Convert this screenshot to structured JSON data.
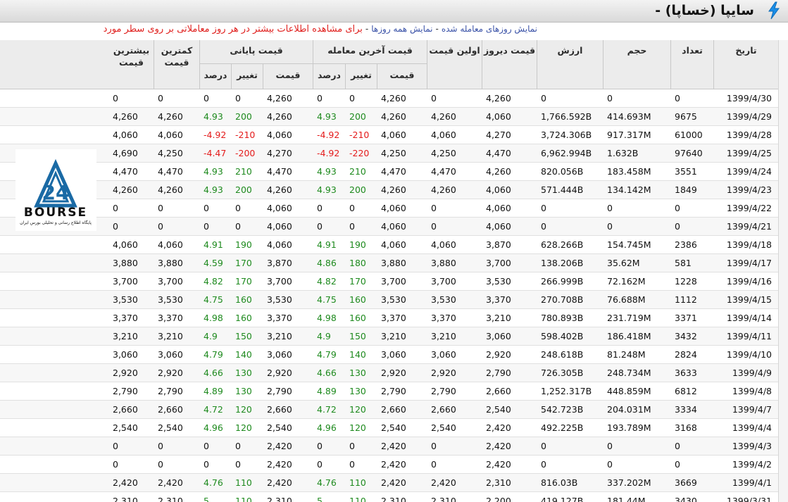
{
  "title": "سایپا (خساپا) -",
  "title_icon": "lightning-icon",
  "info_links": {
    "traded_days": "نمایش روزهای معامله شده",
    "all_days": "نمایش همه روزها",
    "separator": "-",
    "info_text": "برای مشاهده اطلاعات بیشتر در هر روز معاملاتی بر روی سطر مورد"
  },
  "headers": {
    "date": "تاریخ",
    "count": "تعداد",
    "volume": "حجم",
    "value": "ارزش",
    "yesterday_price": "قیمت دیروز",
    "first_price": "اولین قیمت",
    "last_trade_price": "قیمت آخرین معامله",
    "final_price": "قیمت پایانی",
    "price": "قیمت",
    "change": "تغییر",
    "percent": "درصد",
    "lowest_price": "کمترین قیمت",
    "highest_price": "بیشترین قیمت"
  },
  "logo": {
    "text": "BOURSE",
    "subtitle": "پایگاه اطلاع رسانی و تحلیلی بورس ایران",
    "number": "24"
  },
  "colors": {
    "positive": "#1e8a1e",
    "negative": "#e41b1b",
    "header_bg": "#ececec"
  },
  "rows": [
    {
      "date": "1399/4/30",
      "count": "0",
      "volume": "0",
      "value": "0",
      "yesterday": "4,260",
      "first": "0",
      "last_price": "4,260",
      "last_change": "0",
      "last_pct": "0",
      "final_price": "4,260",
      "final_change": "0",
      "final_pct": "0",
      "low": "0",
      "high": "0",
      "dir": ""
    },
    {
      "date": "1399/4/29",
      "count": "9675",
      "volume": "414.693M",
      "value": "1,766.592B",
      "yesterday": "4,060",
      "first": "4,260",
      "last_price": "4,260",
      "last_change": "200",
      "last_pct": "4.93",
      "final_price": "4,260",
      "final_change": "200",
      "final_pct": "4.93",
      "low": "4,260",
      "high": "4,260",
      "dir": "pos"
    },
    {
      "date": "1399/4/28",
      "count": "61000",
      "volume": "917.317M",
      "value": "3,724.306B",
      "yesterday": "4,270",
      "first": "4,060",
      "last_price": "4,060",
      "last_change": "-210",
      "last_pct": "-4.92",
      "final_price": "4,060",
      "final_change": "-210",
      "final_pct": "-4.92",
      "low": "4,060",
      "high": "4,060",
      "dir": "neg"
    },
    {
      "date": "1399/4/25",
      "count": "97640",
      "volume": "1.632B",
      "value": "6,962.994B",
      "yesterday": "4,470",
      "first": "4,250",
      "last_price": "4,250",
      "last_change": "-220",
      "last_pct": "-4.92",
      "final_price": "4,270",
      "final_change": "-200",
      "final_pct": "-4.47",
      "low": "4,250",
      "high": "4,690",
      "dir": "neg"
    },
    {
      "date": "1399/4/24",
      "count": "3551",
      "volume": "183.458M",
      "value": "820.056B",
      "yesterday": "4,260",
      "first": "4,470",
      "last_price": "4,470",
      "last_change": "210",
      "last_pct": "4.93",
      "final_price": "4,470",
      "final_change": "210",
      "final_pct": "4.93",
      "low": "4,470",
      "high": "4,470",
      "dir": "pos"
    },
    {
      "date": "1399/4/23",
      "count": "1849",
      "volume": "134.142M",
      "value": "571.444B",
      "yesterday": "4,060",
      "first": "4,260",
      "last_price": "4,260",
      "last_change": "200",
      "last_pct": "4.93",
      "final_price": "4,260",
      "final_change": "200",
      "final_pct": "4.93",
      "low": "4,260",
      "high": "4,260",
      "dir": "pos"
    },
    {
      "date": "1399/4/22",
      "count": "0",
      "volume": "0",
      "value": "0",
      "yesterday": "4,060",
      "first": "0",
      "last_price": "4,060",
      "last_change": "0",
      "last_pct": "0",
      "final_price": "4,060",
      "final_change": "0",
      "final_pct": "0",
      "low": "0",
      "high": "0",
      "dir": ""
    },
    {
      "date": "1399/4/21",
      "count": "0",
      "volume": "0",
      "value": "0",
      "yesterday": "4,060",
      "first": "0",
      "last_price": "4,060",
      "last_change": "0",
      "last_pct": "0",
      "final_price": "4,060",
      "final_change": "0",
      "final_pct": "0",
      "low": "0",
      "high": "0",
      "dir": ""
    },
    {
      "date": "1399/4/18",
      "count": "2386",
      "volume": "154.745M",
      "value": "628.266B",
      "yesterday": "3,870",
      "first": "4,060",
      "last_price": "4,060",
      "last_change": "190",
      "last_pct": "4.91",
      "final_price": "4,060",
      "final_change": "190",
      "final_pct": "4.91",
      "low": "4,060",
      "high": "4,060",
      "dir": "pos"
    },
    {
      "date": "1399/4/17",
      "count": "581",
      "volume": "35.62M",
      "value": "138.206B",
      "yesterday": "3,700",
      "first": "3,880",
      "last_price": "3,880",
      "last_change": "180",
      "last_pct": "4.86",
      "final_price": "3,870",
      "final_change": "170",
      "final_pct": "4.59",
      "low": "3,880",
      "high": "3,880",
      "dir": "pos"
    },
    {
      "date": "1399/4/16",
      "count": "1228",
      "volume": "72.162M",
      "value": "266.999B",
      "yesterday": "3,530",
      "first": "3,700",
      "last_price": "3,700",
      "last_change": "170",
      "last_pct": "4.82",
      "final_price": "3,700",
      "final_change": "170",
      "final_pct": "4.82",
      "low": "3,700",
      "high": "3,700",
      "dir": "pos"
    },
    {
      "date": "1399/4/15",
      "count": "1112",
      "volume": "76.688M",
      "value": "270.708B",
      "yesterday": "3,370",
      "first": "3,530",
      "last_price": "3,530",
      "last_change": "160",
      "last_pct": "4.75",
      "final_price": "3,530",
      "final_change": "160",
      "final_pct": "4.75",
      "low": "3,530",
      "high": "3,530",
      "dir": "pos"
    },
    {
      "date": "1399/4/14",
      "count": "3371",
      "volume": "231.719M",
      "value": "780.893B",
      "yesterday": "3,210",
      "first": "3,370",
      "last_price": "3,370",
      "last_change": "160",
      "last_pct": "4.98",
      "final_price": "3,370",
      "final_change": "160",
      "final_pct": "4.98",
      "low": "3,370",
      "high": "3,370",
      "dir": "pos"
    },
    {
      "date": "1399/4/11",
      "count": "3432",
      "volume": "186.418M",
      "value": "598.402B",
      "yesterday": "3,060",
      "first": "3,210",
      "last_price": "3,210",
      "last_change": "150",
      "last_pct": "4.9",
      "final_price": "3,210",
      "final_change": "150",
      "final_pct": "4.9",
      "low": "3,210",
      "high": "3,210",
      "dir": "pos"
    },
    {
      "date": "1399/4/10",
      "count": "2824",
      "volume": "81.248M",
      "value": "248.618B",
      "yesterday": "2,920",
      "first": "3,060",
      "last_price": "3,060",
      "last_change": "140",
      "last_pct": "4.79",
      "final_price": "3,060",
      "final_change": "140",
      "final_pct": "4.79",
      "low": "3,060",
      "high": "3,060",
      "dir": "pos"
    },
    {
      "date": "1399/4/9",
      "count": "3633",
      "volume": "248.734M",
      "value": "726.305B",
      "yesterday": "2,790",
      "first": "2,920",
      "last_price": "2,920",
      "last_change": "130",
      "last_pct": "4.66",
      "final_price": "2,920",
      "final_change": "130",
      "final_pct": "4.66",
      "low": "2,920",
      "high": "2,920",
      "dir": "pos"
    },
    {
      "date": "1399/4/8",
      "count": "6812",
      "volume": "448.859M",
      "value": "1,252.317B",
      "yesterday": "2,660",
      "first": "2,790",
      "last_price": "2,790",
      "last_change": "130",
      "last_pct": "4.89",
      "final_price": "2,790",
      "final_change": "130",
      "final_pct": "4.89",
      "low": "2,790",
      "high": "2,790",
      "dir": "pos"
    },
    {
      "date": "1399/4/7",
      "count": "3334",
      "volume": "204.031M",
      "value": "542.723B",
      "yesterday": "2,540",
      "first": "2,660",
      "last_price": "2,660",
      "last_change": "120",
      "last_pct": "4.72",
      "final_price": "2,660",
      "final_change": "120",
      "final_pct": "4.72",
      "low": "2,660",
      "high": "2,660",
      "dir": "pos"
    },
    {
      "date": "1399/4/4",
      "count": "3168",
      "volume": "193.789M",
      "value": "492.225B",
      "yesterday": "2,420",
      "first": "2,540",
      "last_price": "2,540",
      "last_change": "120",
      "last_pct": "4.96",
      "final_price": "2,540",
      "final_change": "120",
      "final_pct": "4.96",
      "low": "2,540",
      "high": "2,540",
      "dir": "pos"
    },
    {
      "date": "1399/4/3",
      "count": "0",
      "volume": "0",
      "value": "0",
      "yesterday": "2,420",
      "first": "0",
      "last_price": "2,420",
      "last_change": "0",
      "last_pct": "0",
      "final_price": "2,420",
      "final_change": "0",
      "final_pct": "0",
      "low": "0",
      "high": "0",
      "dir": ""
    },
    {
      "date": "1399/4/2",
      "count": "0",
      "volume": "0",
      "value": "0",
      "yesterday": "2,420",
      "first": "0",
      "last_price": "2,420",
      "last_change": "0",
      "last_pct": "0",
      "final_price": "2,420",
      "final_change": "0",
      "final_pct": "0",
      "low": "0",
      "high": "0",
      "dir": ""
    },
    {
      "date": "1399/4/1",
      "count": "3669",
      "volume": "337.202M",
      "value": "816.03B",
      "yesterday": "2,310",
      "first": "2,420",
      "last_price": "2,420",
      "last_change": "110",
      "last_pct": "4.76",
      "final_price": "2,420",
      "final_change": "110",
      "final_pct": "4.76",
      "low": "2,420",
      "high": "2,420",
      "dir": "pos"
    },
    {
      "date": "1399/3/31",
      "count": "3430",
      "volume": "181.44M",
      "value": "419.127B",
      "yesterday": "2,200",
      "first": "2,310",
      "last_price": "2,310",
      "last_change": "110",
      "last_pct": "5",
      "final_price": "2,310",
      "final_change": "110",
      "final_pct": "5",
      "low": "2,310",
      "high": "2,310",
      "dir": "pos"
    }
  ]
}
